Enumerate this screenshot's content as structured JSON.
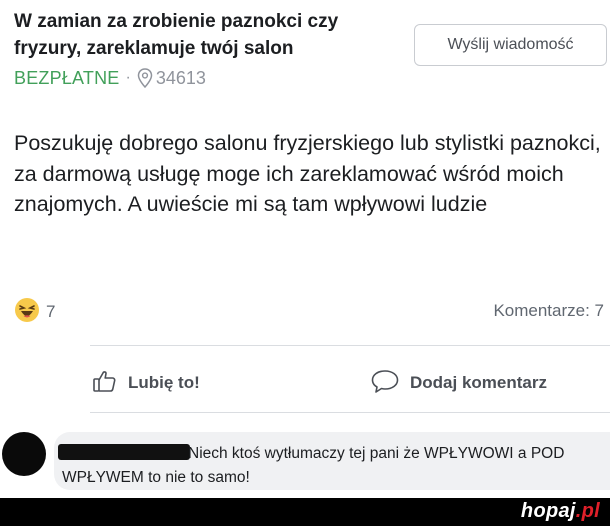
{
  "listing": {
    "title": "W zamian za zrobienie paznokci czy fryzury, zareklamuje twój salon",
    "send_message_label": "Wyślij wiadomość",
    "price": "BEZPŁATNE",
    "separator": "·",
    "location_code": "34613",
    "body": "Poszukuję dobrego salonu fryzjerskiego lub stylistki paznokci,  za darmową usługę moge ich zareklamować wśród moich znajomych. A uwieście mi są tam wpływowi ludzie"
  },
  "engagement": {
    "reaction_count": "7",
    "comments_label": "Komentarze: 7"
  },
  "actions": {
    "like_label": "Lubię to!",
    "comment_label": "Dodaj komentarz"
  },
  "comment": {
    "text": "Niech ktoś wytłumaczy tej pani że WPŁYWOWI a POD WPŁYWEM to nie to samo!"
  },
  "watermark": {
    "name": "hopaj",
    "tld": ".pl"
  },
  "colors": {
    "price_green": "#42a05a",
    "secondary_gray": "#90949c",
    "footer_black": "#000000",
    "logo_red": "#e0202a"
  },
  "icons": [
    "location-pin-icon",
    "laugh-reaction-icon",
    "thumbs-up-icon",
    "comment-bubble-icon"
  ]
}
